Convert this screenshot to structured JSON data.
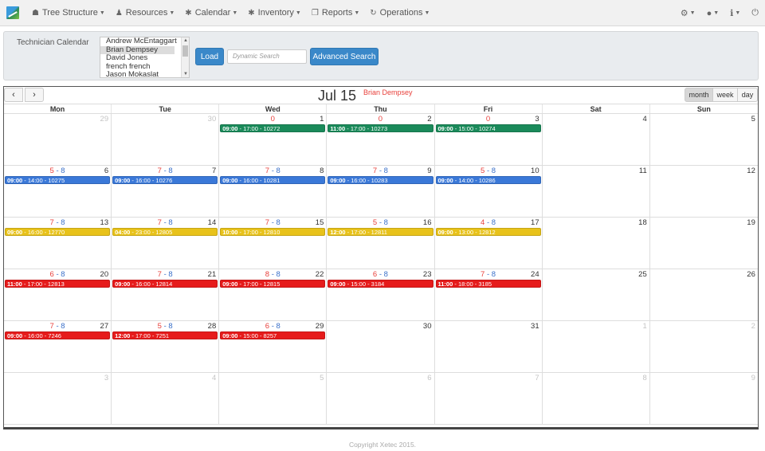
{
  "navbar": {
    "items": [
      {
        "label": "Tree Structure",
        "icon": "tree-icon"
      },
      {
        "label": "Resources",
        "icon": "resources-icon"
      },
      {
        "label": "Calendar",
        "icon": "asterisk-icon"
      },
      {
        "label": "Inventory",
        "icon": "asterisk-icon"
      },
      {
        "label": "Reports",
        "icon": "reports-icon"
      },
      {
        "label": "Operations",
        "icon": "refresh-icon"
      }
    ],
    "right": [
      {
        "icon": "gear-icon"
      },
      {
        "icon": "globe-icon"
      },
      {
        "icon": "info-icon"
      },
      {
        "icon": "power-icon"
      }
    ]
  },
  "filter": {
    "label": "Technician Calendar",
    "technicians": [
      "Andrew McEntaggart",
      "Brian Dempsey",
      "David Jones",
      "french french",
      "Jason Mokaslat"
    ],
    "selected": "Brian Dempsey",
    "load_label": "Load",
    "search_placeholder": "Dynamic Search",
    "advanced_label": "Advanced Search"
  },
  "calendar": {
    "title": "Jul 15",
    "technician": "Brian Dempsey",
    "prev_label": "‹",
    "next_label": "›",
    "views": [
      "month",
      "week",
      "day"
    ],
    "active_view": "month",
    "weekdays": [
      "Mon",
      "Tue",
      "Wed",
      "Thu",
      "Fri",
      "Sat",
      "Sun"
    ],
    "colors": {
      "green": "#1a8a5a",
      "blue": "#3a78d8",
      "yellow": "#e8c21a",
      "red": "#e61b1b"
    },
    "weeks": [
      [
        {
          "day": "29",
          "other": true
        },
        {
          "day": "30",
          "other": true
        },
        {
          "day": "1",
          "count": "0",
          "event": {
            "start": "09:00",
            "rest": " - 17:00 - 10272",
            "color": "green"
          }
        },
        {
          "day": "2",
          "count": "0",
          "event": {
            "start": "11:00",
            "rest": " - 17:00 - 10273",
            "color": "green"
          }
        },
        {
          "day": "3",
          "count": "0",
          "event": {
            "start": "09:00",
            "rest": " - 15:00 - 10274",
            "color": "green"
          }
        },
        {
          "day": "4"
        },
        {
          "day": "5"
        }
      ],
      [
        {
          "day": "6",
          "count": "5",
          "total": "8",
          "event": {
            "start": "09:00",
            "rest": " - 14:00 - 10275",
            "color": "blue"
          }
        },
        {
          "day": "7",
          "count": "7",
          "total": "8",
          "event": {
            "start": "09:00",
            "rest": " - 16:00 - 10276",
            "color": "blue"
          }
        },
        {
          "day": "8",
          "count": "7",
          "total": "8",
          "event": {
            "start": "09:00",
            "rest": " - 16:00 - 10281",
            "color": "blue"
          }
        },
        {
          "day": "9",
          "count": "7",
          "total": "8",
          "event": {
            "start": "09:00",
            "rest": " - 16:00 - 10283",
            "color": "blue"
          }
        },
        {
          "day": "10",
          "count": "5",
          "total": "8",
          "event": {
            "start": "09:00",
            "rest": " - 14:00 - 10286",
            "color": "blue"
          }
        },
        {
          "day": "11"
        },
        {
          "day": "12"
        }
      ],
      [
        {
          "day": "13",
          "count": "7",
          "total": "8",
          "event": {
            "start": "09:00",
            "rest": " - 16:00 - 12770",
            "color": "yellow"
          }
        },
        {
          "day": "14",
          "count": "7",
          "total": "8",
          "event": {
            "start": "04:00",
            "rest": " - 23:00 - 12805",
            "color": "yellow"
          }
        },
        {
          "day": "15",
          "count": "7",
          "total": "8",
          "event": {
            "start": "10:00",
            "rest": " - 17:00 - 12810",
            "color": "yellow"
          }
        },
        {
          "day": "16",
          "count": "5",
          "total": "8",
          "event": {
            "start": "12:00",
            "rest": " - 17:00 - 12811",
            "color": "yellow"
          }
        },
        {
          "day": "17",
          "count": "4",
          "total": "8",
          "event": {
            "start": "09:00",
            "rest": " - 13:00 - 12812",
            "color": "yellow"
          }
        },
        {
          "day": "18"
        },
        {
          "day": "19"
        }
      ],
      [
        {
          "day": "20",
          "count": "6",
          "total": "8",
          "event": {
            "start": "11:00",
            "rest": " - 17:00 - 12813",
            "color": "red"
          }
        },
        {
          "day": "21",
          "count": "7",
          "total": "8",
          "event": {
            "start": "09:00",
            "rest": " - 16:00 - 12814",
            "color": "red"
          }
        },
        {
          "day": "22",
          "count": "8",
          "total": "8",
          "event": {
            "start": "09:00",
            "rest": " - 17:00 - 12815",
            "color": "red"
          }
        },
        {
          "day": "23",
          "count": "6",
          "total": "8",
          "event": {
            "start": "09:00",
            "rest": " - 15:00 - 3184",
            "color": "red"
          }
        },
        {
          "day": "24",
          "count": "7",
          "total": "8",
          "event": {
            "start": "11:00",
            "rest": " - 18:00 - 3185",
            "color": "red"
          }
        },
        {
          "day": "25"
        },
        {
          "day": "26"
        }
      ],
      [
        {
          "day": "27",
          "count": "7",
          "total": "8",
          "event": {
            "start": "09:00",
            "rest": " - 16:00 - 7246",
            "color": "red"
          }
        },
        {
          "day": "28",
          "count": "5",
          "total": "8",
          "event": {
            "start": "12:00",
            "rest": " - 17:00 - 7251",
            "color": "red"
          }
        },
        {
          "day": "29",
          "count": "6",
          "total": "8",
          "event": {
            "start": "09:00",
            "rest": " - 15:00 - 8257",
            "color": "red"
          }
        },
        {
          "day": "30"
        },
        {
          "day": "31"
        },
        {
          "day": "1",
          "other": true
        },
        {
          "day": "2",
          "other": true
        }
      ],
      [
        {
          "day": "3",
          "other": true
        },
        {
          "day": "4",
          "other": true
        },
        {
          "day": "5",
          "other": true
        },
        {
          "day": "6",
          "other": true
        },
        {
          "day": "7",
          "other": true
        },
        {
          "day": "8",
          "other": true
        },
        {
          "day": "9",
          "other": true
        }
      ]
    ]
  },
  "footer": {
    "text": "Copyright Xetec 2015."
  }
}
